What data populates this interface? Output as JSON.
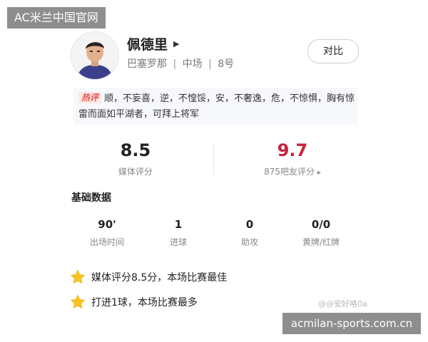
{
  "watermark_top": "AC米兰中国官网",
  "player": {
    "name": "佩德里",
    "club": "巴塞罗那",
    "position": "中场",
    "number": "8号"
  },
  "compare_button": "对比",
  "hot_comment": {
    "badge": "热评",
    "text": "顺，不妄喜，逆，不惶馁，安，不奢逸，危，不惊惧，胸有惊雷而面如平湖者，可拜上将军"
  },
  "scores": {
    "media_value": "8.5",
    "media_label": "媒体评分",
    "fan_value": "9.7",
    "fan_label": "875吧友评分",
    "fan_arrow": "▸"
  },
  "basic_data": {
    "title": "基础数据",
    "stats": [
      {
        "value": "90'",
        "label": "出场时间"
      },
      {
        "value": "1",
        "label": "进球"
      },
      {
        "value": "0",
        "label": "助攻"
      },
      {
        "value": "0/0",
        "label": "黄牌/红牌"
      }
    ]
  },
  "highlights": [
    {
      "icon": "star-icon",
      "text": "媒体评分8.5分，本场比赛最佳"
    },
    {
      "icon": "star-icon",
      "text": "打进1球，本场比赛最多"
    }
  ],
  "watermark_mid": "@@安好咯0a",
  "watermark_bottom": "acmilan-sports.com.cn",
  "colors": {
    "fan_score": "#c8213a",
    "hot_badge_bg": "#ffe8e5",
    "hot_badge_text": "#e0574f",
    "star": "#f7c325",
    "watermark_bg": "#8e8e8e"
  }
}
